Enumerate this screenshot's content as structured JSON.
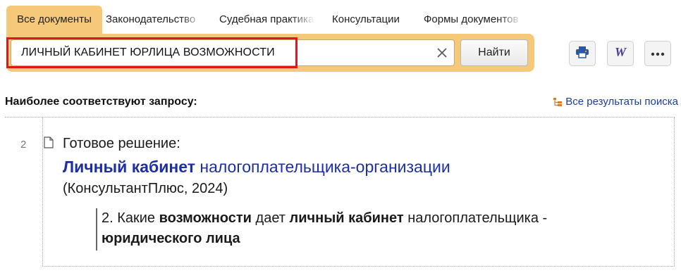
{
  "tabs": [
    {
      "label": "Все документы",
      "active": true
    },
    {
      "label": "Законодательство",
      "active": false
    },
    {
      "label": "Судебная практика",
      "active": false
    },
    {
      "label": "Консультации",
      "active": false
    },
    {
      "label": "Формы документов",
      "active": false
    }
  ],
  "search": {
    "query": "ЛИЧНЫЙ КАБИНЕТ ЮРЛИЦА ВОЗМОЖНОСТИ",
    "clear_icon": "close-icon",
    "find_label": "Найти"
  },
  "toolbar": {
    "print_icon": "printer-icon",
    "word_icon": "word-export-icon",
    "more_icon": "more-dots-icon"
  },
  "results": {
    "header": "Наиболее соответствуют запросу:",
    "all_results_label": "Все результаты поиска",
    "item": {
      "number": "2",
      "type": "Готовое решение:",
      "title_bold": "Личный кабинет",
      "title_rest": " налогоплательщика-организации",
      "source": "(КонсультантПлюс, 2024)",
      "snippet_parts": [
        {
          "text": "2. Какие ",
          "bold": false
        },
        {
          "text": "возможности",
          "bold": true
        },
        {
          "text": " дает ",
          "bold": false
        },
        {
          "text": "личный кабинет",
          "bold": true
        },
        {
          "text": " налогоплательщика - ",
          "bold": false
        },
        {
          "text": "юридического лица",
          "bold": true
        }
      ]
    }
  },
  "colors": {
    "accent": "#f6c97a",
    "highlight": "#e3141b",
    "link": "#1c2fa3"
  }
}
